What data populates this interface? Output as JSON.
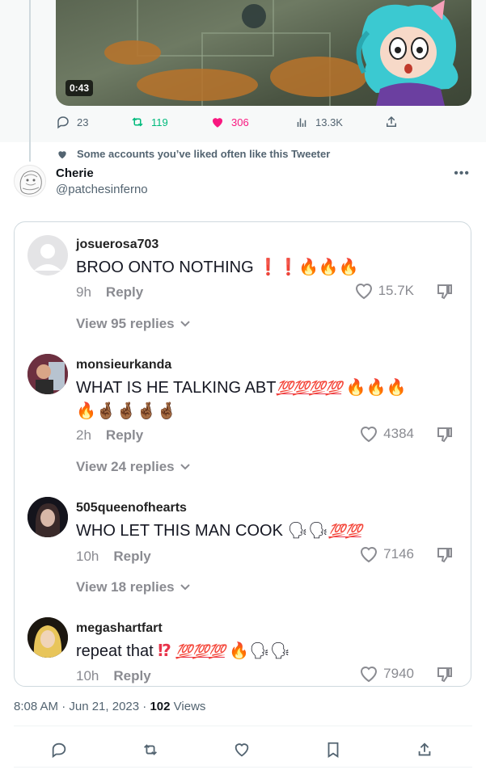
{
  "quoted_video": {
    "duration": "0:43",
    "stats": {
      "replies": "23",
      "retweets": "119",
      "likes": "306",
      "views": "13.3K"
    }
  },
  "social_context": "Some accounts you’ve liked often like this Tweeter",
  "tweet": {
    "display_name": "Cherie",
    "handle": "@patchesinferno",
    "more_label": "•••",
    "time": "8:08 AM · Jun 21, 2023",
    "views_count": "102",
    "views_label": "Views"
  },
  "screenshot_comments": [
    {
      "username": "josuerosa703",
      "text": "BROO ONTO NOTHING",
      "emoji": "❗❗🔥🔥🔥",
      "age": "9h",
      "reply_label": "Reply",
      "likes": "15.7K",
      "view_replies": "View 95 replies"
    },
    {
      "username": "monsieurkanda",
      "text": "WHAT IS HE TALKING ABT",
      "emoji_hundreds": "💯💯💯💯",
      "emoji": "🔥🔥🔥",
      "emoji_line2": "🔥🤞🏾🤞🏾🤞🏾🤞🏾",
      "age": "2h",
      "reply_label": "Reply",
      "likes": "4384",
      "view_replies": "View 24 replies"
    },
    {
      "username": "505queenofhearts",
      "text": "WHO LET THIS MAN COOK",
      "emoji": "🗣🗣",
      "emoji_hundreds": "💯💯",
      "age": "10h",
      "reply_label": "Reply",
      "likes": "7146",
      "view_replies": "View 18 replies"
    },
    {
      "username": "megashartfart",
      "text": "repeat that",
      "emoji_bang": "⁉",
      "emoji_hundreds": "💯💯💯",
      "emoji": "🔥🗣🗣",
      "age": "10h",
      "reply_label": "Reply",
      "likes": "7940"
    }
  ],
  "colors": {
    "accent_blue": "#1d9bf0",
    "retweet_green": "#00ba7c",
    "like_pink": "#f91880",
    "secondary_text": "#536471",
    "tiktok_gray": "#8a8b91"
  },
  "icons": [
    "reply-icon",
    "retweet-icon",
    "heart-icon",
    "analytics-icon",
    "share-icon",
    "bookmark-icon",
    "chevron-down-icon",
    "dislike-icon",
    "more-icon"
  ]
}
